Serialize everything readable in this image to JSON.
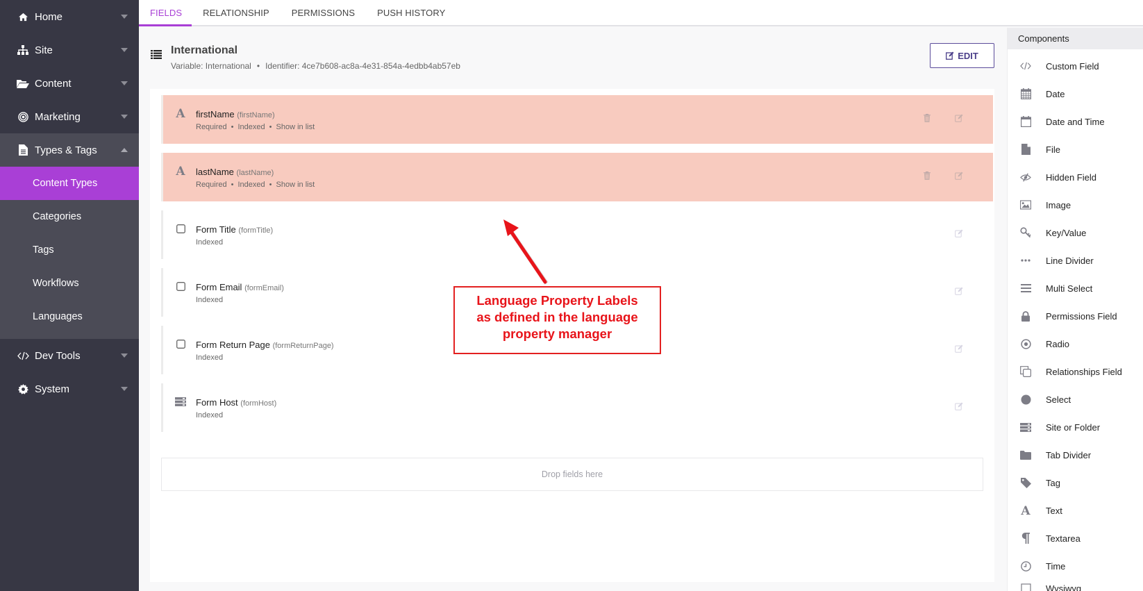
{
  "sidebar": {
    "items": [
      {
        "label": "Home",
        "icon": "home-icon"
      },
      {
        "label": "Site",
        "icon": "sitemap-icon"
      },
      {
        "label": "Content",
        "icon": "folder-open-icon"
      },
      {
        "label": "Marketing",
        "icon": "bullseye-icon"
      },
      {
        "label": "Types & Tags",
        "icon": "file-text-icon",
        "expanded": true,
        "children": [
          "Content Types",
          "Categories",
          "Tags",
          "Workflows",
          "Languages"
        ],
        "active_child": "Content Types"
      },
      {
        "label": "Dev Tools",
        "icon": "code-icon"
      },
      {
        "label": "System",
        "icon": "gear-icon"
      }
    ]
  },
  "tabs": [
    {
      "label": "FIELDS",
      "active": true
    },
    {
      "label": "RELATIONSHIP"
    },
    {
      "label": "PERMISSIONS"
    },
    {
      "label": "PUSH HISTORY"
    }
  ],
  "content_type": {
    "title": "International",
    "variable_label": "Variable: International",
    "identifier_label": "Identifier: 4ce7b608-ac8a-4e31-854a-4edbb4ab57eb",
    "separator": "•",
    "edit_label": "EDIT"
  },
  "fields": [
    {
      "name": "firstName",
      "variable": "(firstName)",
      "icon": "text-icon",
      "props": [
        "Required",
        "Indexed",
        "Show in list"
      ],
      "required": true
    },
    {
      "name": "lastName",
      "variable": "(lastName)",
      "icon": "text-icon",
      "props": [
        "Required",
        "Indexed",
        "Show in list"
      ],
      "required": true
    },
    {
      "name": "Form Title",
      "variable": "(formTitle)",
      "icon": "checkbox-icon",
      "props": [
        "Indexed"
      ],
      "required": false
    },
    {
      "name": "Form Email",
      "variable": "(formEmail)",
      "icon": "checkbox-icon",
      "props": [
        "Indexed"
      ],
      "required": false
    },
    {
      "name": "Form Return Page",
      "variable": "(formReturnPage)",
      "icon": "checkbox-icon",
      "props": [
        "Indexed"
      ],
      "required": false
    },
    {
      "name": "Form Host",
      "variable": "(formHost)",
      "icon": "server-icon",
      "props": [
        "Indexed"
      ],
      "required": false
    }
  ],
  "drop_zone": "Drop fields here",
  "annotation": {
    "lines": [
      "Language Property Labels",
      "as defined in the language",
      "property manager"
    ],
    "color": "#e8141a"
  },
  "components": {
    "header": "Components",
    "items": [
      {
        "label": "Custom Field",
        "icon": "code-icon"
      },
      {
        "label": "Date",
        "icon": "calendar-icon"
      },
      {
        "label": "Date and Time",
        "icon": "calendar-empty-icon"
      },
      {
        "label": "File",
        "icon": "file-icon"
      },
      {
        "label": "Hidden Field",
        "icon": "eye-slash-icon"
      },
      {
        "label": "Image",
        "icon": "image-icon"
      },
      {
        "label": "Key/Value",
        "icon": "key-icon"
      },
      {
        "label": "Line Divider",
        "icon": "ellipsis-icon"
      },
      {
        "label": "Multi Select",
        "icon": "bars-icon"
      },
      {
        "label": "Permissions Field",
        "icon": "lock-icon"
      },
      {
        "label": "Radio",
        "icon": "dot-circle-icon"
      },
      {
        "label": "Relationships Field",
        "icon": "clone-icon"
      },
      {
        "label": "Select",
        "icon": "circle-icon"
      },
      {
        "label": "Site or Folder",
        "icon": "server-icon"
      },
      {
        "label": "Tab Divider",
        "icon": "folder-icon"
      },
      {
        "label": "Tag",
        "icon": "tag-icon"
      },
      {
        "label": "Text",
        "icon": "text-icon"
      },
      {
        "label": "Textarea",
        "icon": "paragraph-icon"
      },
      {
        "label": "Time",
        "icon": "clock-icon"
      },
      {
        "label": "Wysiwyg",
        "icon": "wysiwyg-icon"
      }
    ]
  },
  "colors": {
    "accent": "#a93fd6",
    "sidebar": "#373744",
    "required_row": "#f8cbbf",
    "edit_button": "#5b4c9a"
  }
}
